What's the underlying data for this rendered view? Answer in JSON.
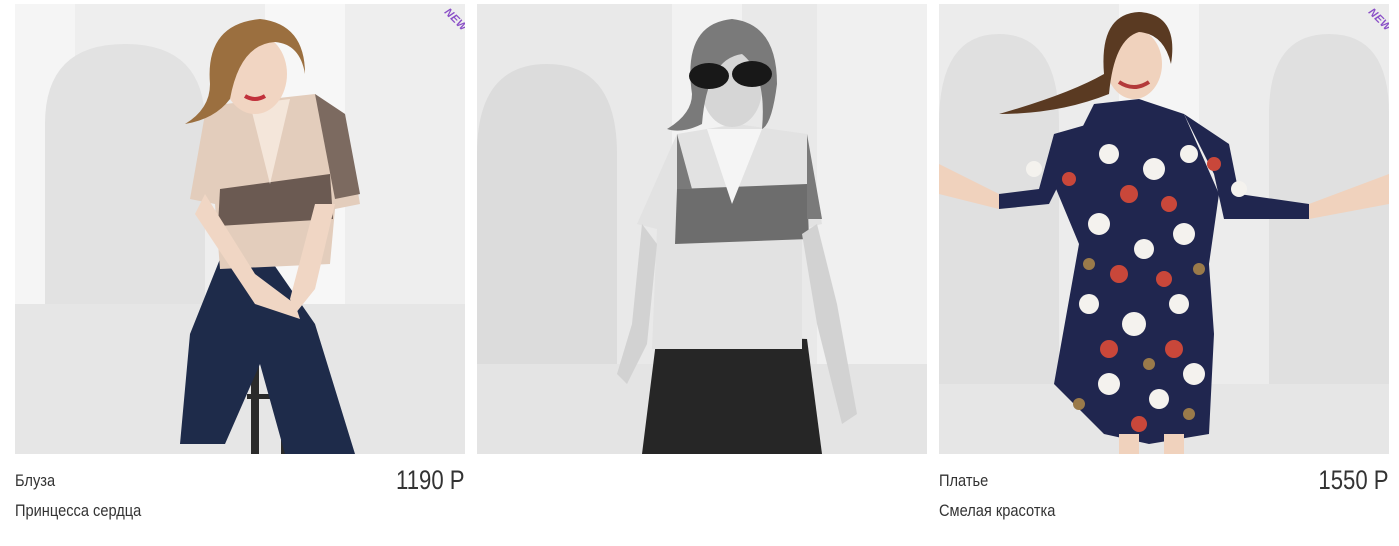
{
  "products": [
    {
      "badge": "NEW",
      "type": "Блуза",
      "name": "Принцесса сердца",
      "price": "1190 Р",
      "photo": "woman-seated-beige-houndstooth-blouse-photo"
    },
    {
      "badge": "",
      "type": "",
      "name": "",
      "price": "",
      "photo": "woman-sunglasses-blouse-bw-photo"
    },
    {
      "badge": "NEW",
      "type": "Платье",
      "name": "Смелая красотка",
      "price": "1550 Р",
      "photo": "woman-floral-navy-dress-photo"
    }
  ],
  "colors": {
    "badge": "#8a4fc7",
    "text": "#333333",
    "background": "#ffffff"
  }
}
